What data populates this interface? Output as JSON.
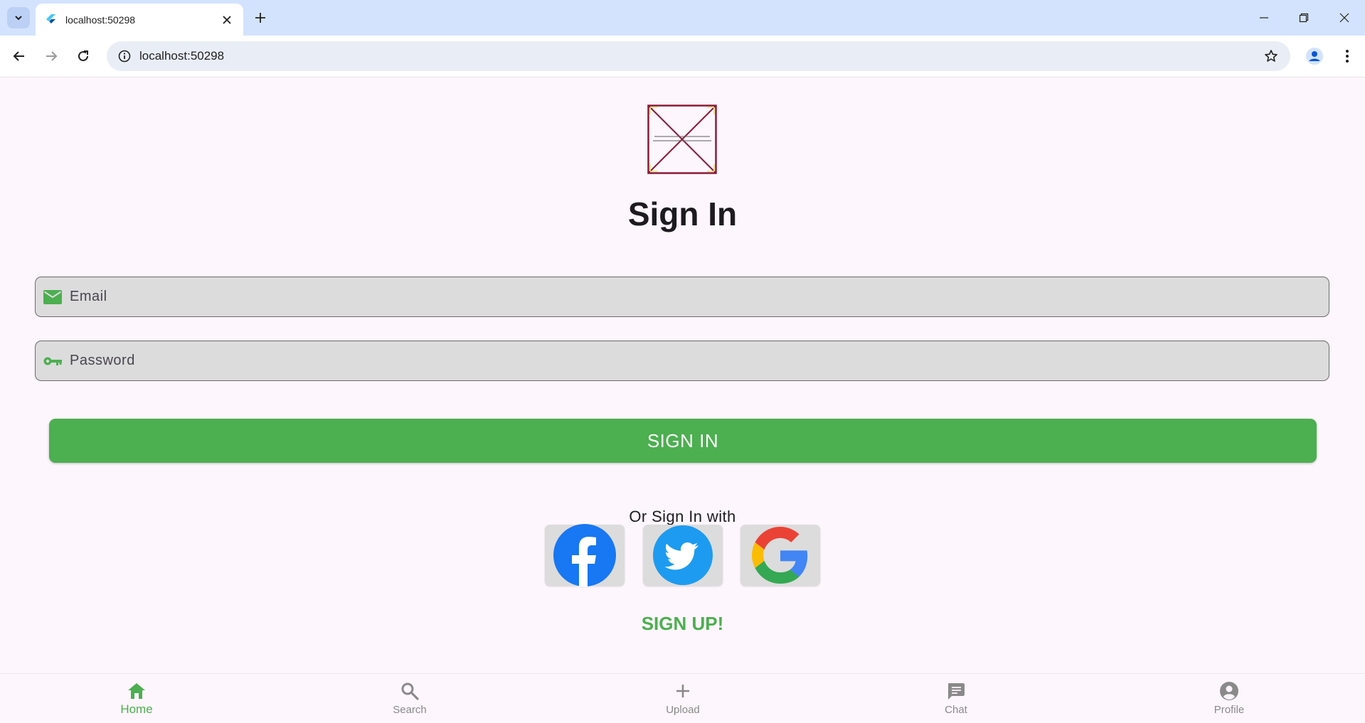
{
  "browser": {
    "tab_title": "localhost:50298",
    "url": "localhost:50298"
  },
  "page": {
    "title": "Sign In",
    "email_placeholder": "Email",
    "password_placeholder": "Password",
    "signin_label": "SIGN IN",
    "or_text": "Or Sign In with",
    "signup_label": "SIGN UP!",
    "social": [
      "facebook",
      "twitter",
      "google"
    ],
    "accent_color": "#4caf50"
  },
  "bottom_nav": {
    "items": [
      {
        "label": "Home",
        "icon": "home-icon",
        "active": true
      },
      {
        "label": "Search",
        "icon": "search-icon",
        "active": false
      },
      {
        "label": "Upload",
        "icon": "plus-icon",
        "active": false
      },
      {
        "label": "Chat",
        "icon": "chat-icon",
        "active": false
      },
      {
        "label": "Profile",
        "icon": "profile-icon",
        "active": false
      }
    ]
  }
}
